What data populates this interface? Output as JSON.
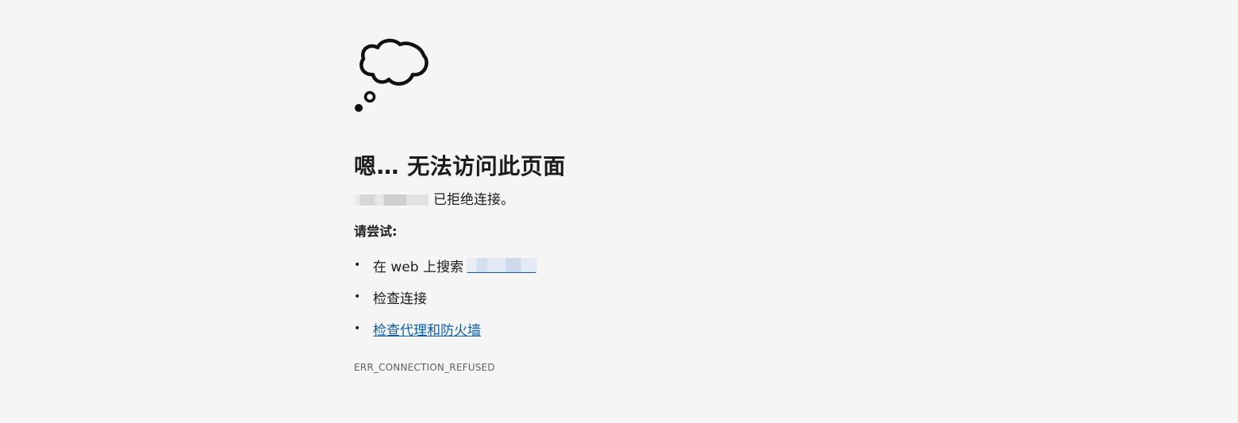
{
  "error_page": {
    "heading": "嗯… 无法访问此页面",
    "refused_text": "已拒绝连接。",
    "try_label": "请尝试:",
    "suggestions": [
      {
        "bullet": "•",
        "text": "在 web 上搜索"
      },
      {
        "bullet": "•",
        "text": "检查连接"
      },
      {
        "bullet": "•",
        "text": "检查代理和防火墙"
      }
    ],
    "error_code": "ERR_CONNECTION_REFUSED"
  },
  "icons": {
    "cloud": "thought-cloud-icon"
  },
  "colors": {
    "background": "#f5f5f5",
    "text": "#1b1b1b",
    "link": "#0f5fa8",
    "muted": "#616161"
  }
}
